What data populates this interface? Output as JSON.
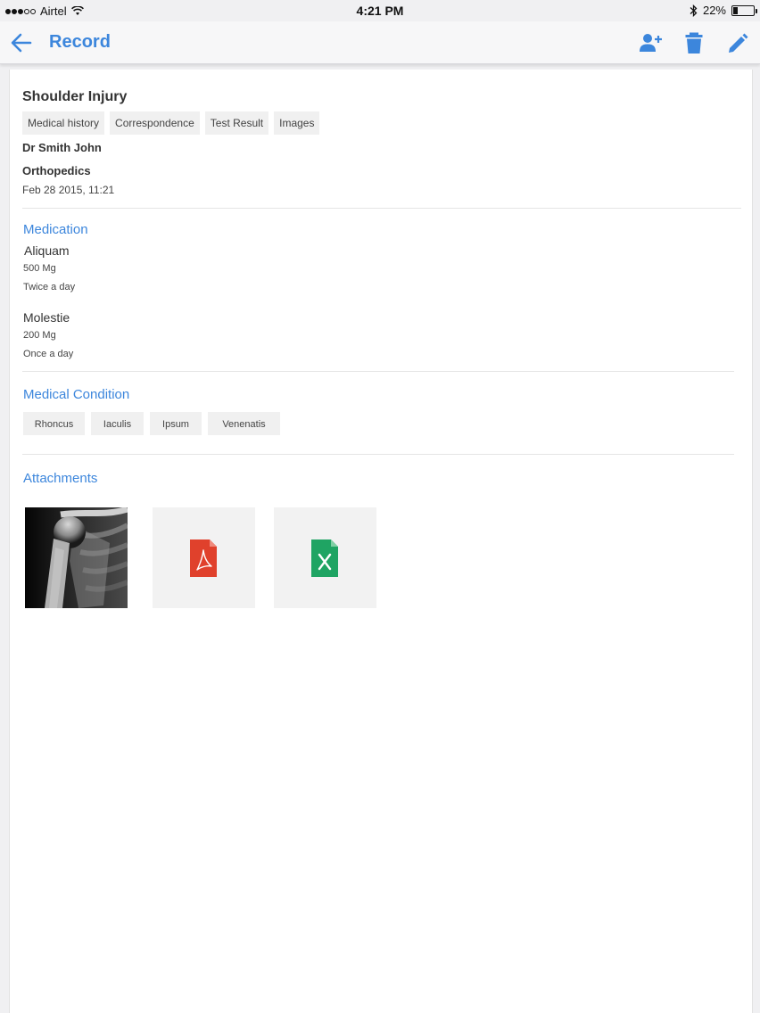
{
  "status_bar": {
    "carrier": "Airtel",
    "time": "4:21 PM",
    "battery": "22%",
    "battery_level": 0.22
  },
  "nav": {
    "title": "Record"
  },
  "record": {
    "title": "Shoulder Injury",
    "tabs": [
      "Medical history",
      "Correspondence",
      "Test Result",
      "Images"
    ],
    "doctor": "Dr Smith John",
    "department": "Orthopedics",
    "datetime": "Feb 28 2015, 11:21"
  },
  "medication": {
    "title": "Medication",
    "items": [
      {
        "name": "Aliquam",
        "dose": "500 Mg",
        "frequency": "Twice a day"
      },
      {
        "name": "Molestie",
        "dose": "200 Mg",
        "frequency": "Once a day"
      }
    ]
  },
  "medical_condition": {
    "title": "Medical Condition",
    "items": [
      "Rhoncus",
      "Iaculis",
      "Ipsum",
      "Venenatis"
    ]
  },
  "attachments": {
    "title": "Attachments",
    "items": [
      {
        "type": "image",
        "icon": "xray-image"
      },
      {
        "type": "pdf",
        "icon": "pdf-file-icon"
      },
      {
        "type": "excel",
        "icon": "excel-file-icon"
      }
    ]
  },
  "colors": {
    "accent": "#3c86dc",
    "pdf": "#e0412c",
    "excel": "#1fa463"
  }
}
